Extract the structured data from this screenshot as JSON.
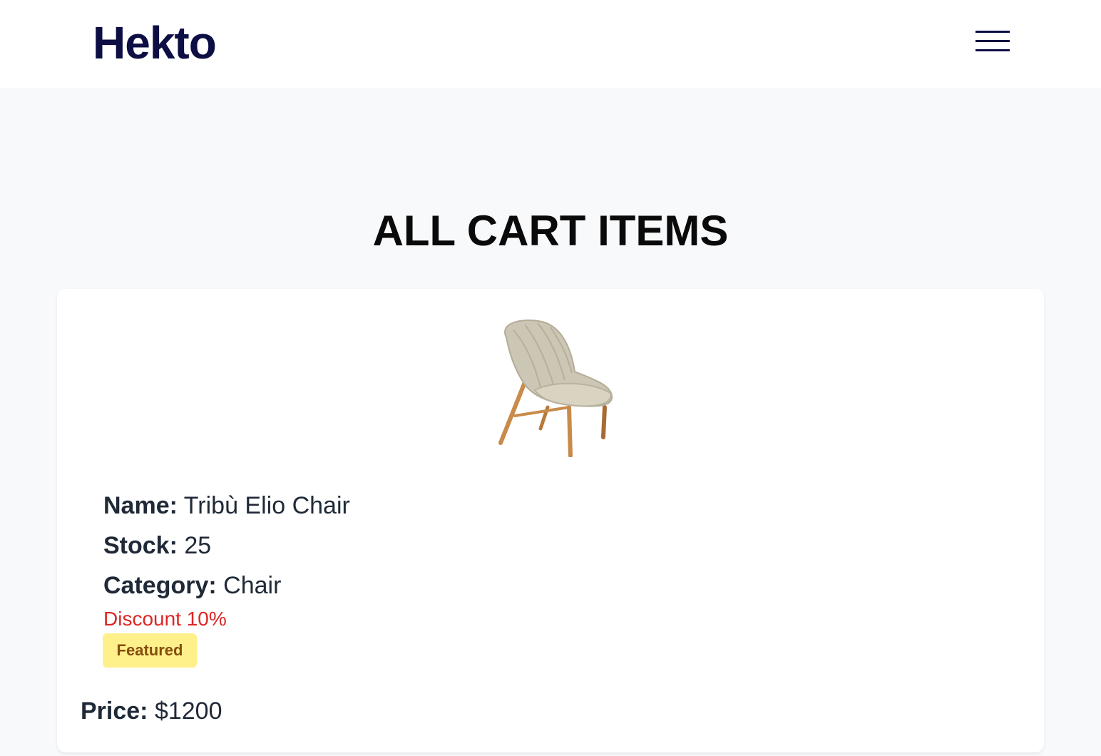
{
  "header": {
    "logo": "Hekto",
    "menu_icon": "hamburger-menu-icon"
  },
  "page": {
    "title": "ALL CART ITEMS"
  },
  "cart_items": [
    {
      "image_icon": "lounge-chair-image",
      "name_label": "Name:",
      "name": "Tribù Elio Chair",
      "stock_label": "Stock:",
      "stock": "25",
      "category_label": "Category:",
      "category": "Chair",
      "discount_text": "Discount 10%",
      "badge": "Featured",
      "price_label": "Price:",
      "price": "$1200"
    }
  ],
  "colors": {
    "brand": "#0d0e43",
    "discount": "#dc2626",
    "badge_bg": "#fef08a",
    "badge_text": "#854d0e",
    "page_bg": "#f8f9fb"
  }
}
